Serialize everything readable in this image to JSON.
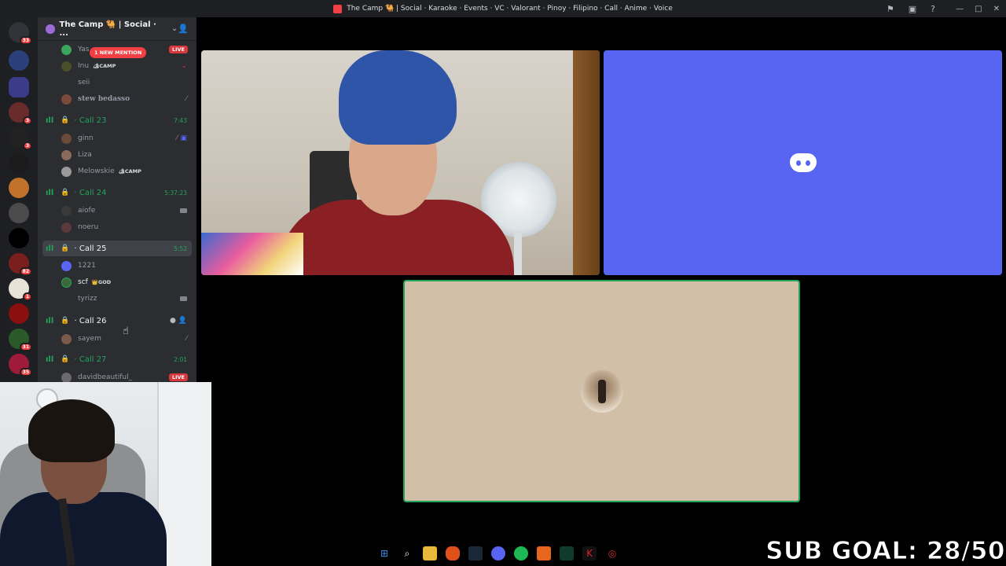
{
  "window": {
    "title": "The Camp 🐫 | Social · Karaoke · Events · VC · Valorant · Pinoy · Filipino · Call · Anime · Voice"
  },
  "rail": {
    "badges": [
      "33",
      "3",
      "3",
      "82",
      "1",
      "31",
      "35"
    ]
  },
  "server": {
    "name": "The Camp 🐫 | Social · ...",
    "new_mention_label": "1 NEW MENTION"
  },
  "channels": [
    {
      "rows": [
        {
          "kind": "user",
          "name": "Yas",
          "live": "LIVE"
        },
        {
          "kind": "user",
          "name": "Inu",
          "tag": "🏕CAMP"
        },
        {
          "kind": "user",
          "name": "seii"
        },
        {
          "kind": "user",
          "name": "stew bedasso"
        }
      ]
    },
    {
      "name": "Call 23",
      "timer": "7:43",
      "users": [
        {
          "name": "ginn"
        },
        {
          "name": "Liza"
        },
        {
          "name": "Melowskie",
          "tag": "🏕CAMP"
        }
      ]
    },
    {
      "name": "Call 24",
      "timer": "5:37:23",
      "users": [
        {
          "name": "aiofe"
        },
        {
          "name": "noeru"
        }
      ]
    },
    {
      "name": "Call 25",
      "timer": "5:52",
      "users": [
        {
          "name": "1221"
        },
        {
          "name": "scf",
          "tag": "👑GOD"
        },
        {
          "name": "tyrizz"
        }
      ]
    },
    {
      "name": "Call 26",
      "users": [
        {
          "name": "sayem"
        }
      ]
    },
    {
      "name": "Call 27",
      "timer": "2:01",
      "users": [
        {
          "name": "davidbeautiful_",
          "live": "LIVE"
        }
      ]
    }
  ],
  "overlay": {
    "sub_goal": "SUB GOAL: 28/50"
  }
}
